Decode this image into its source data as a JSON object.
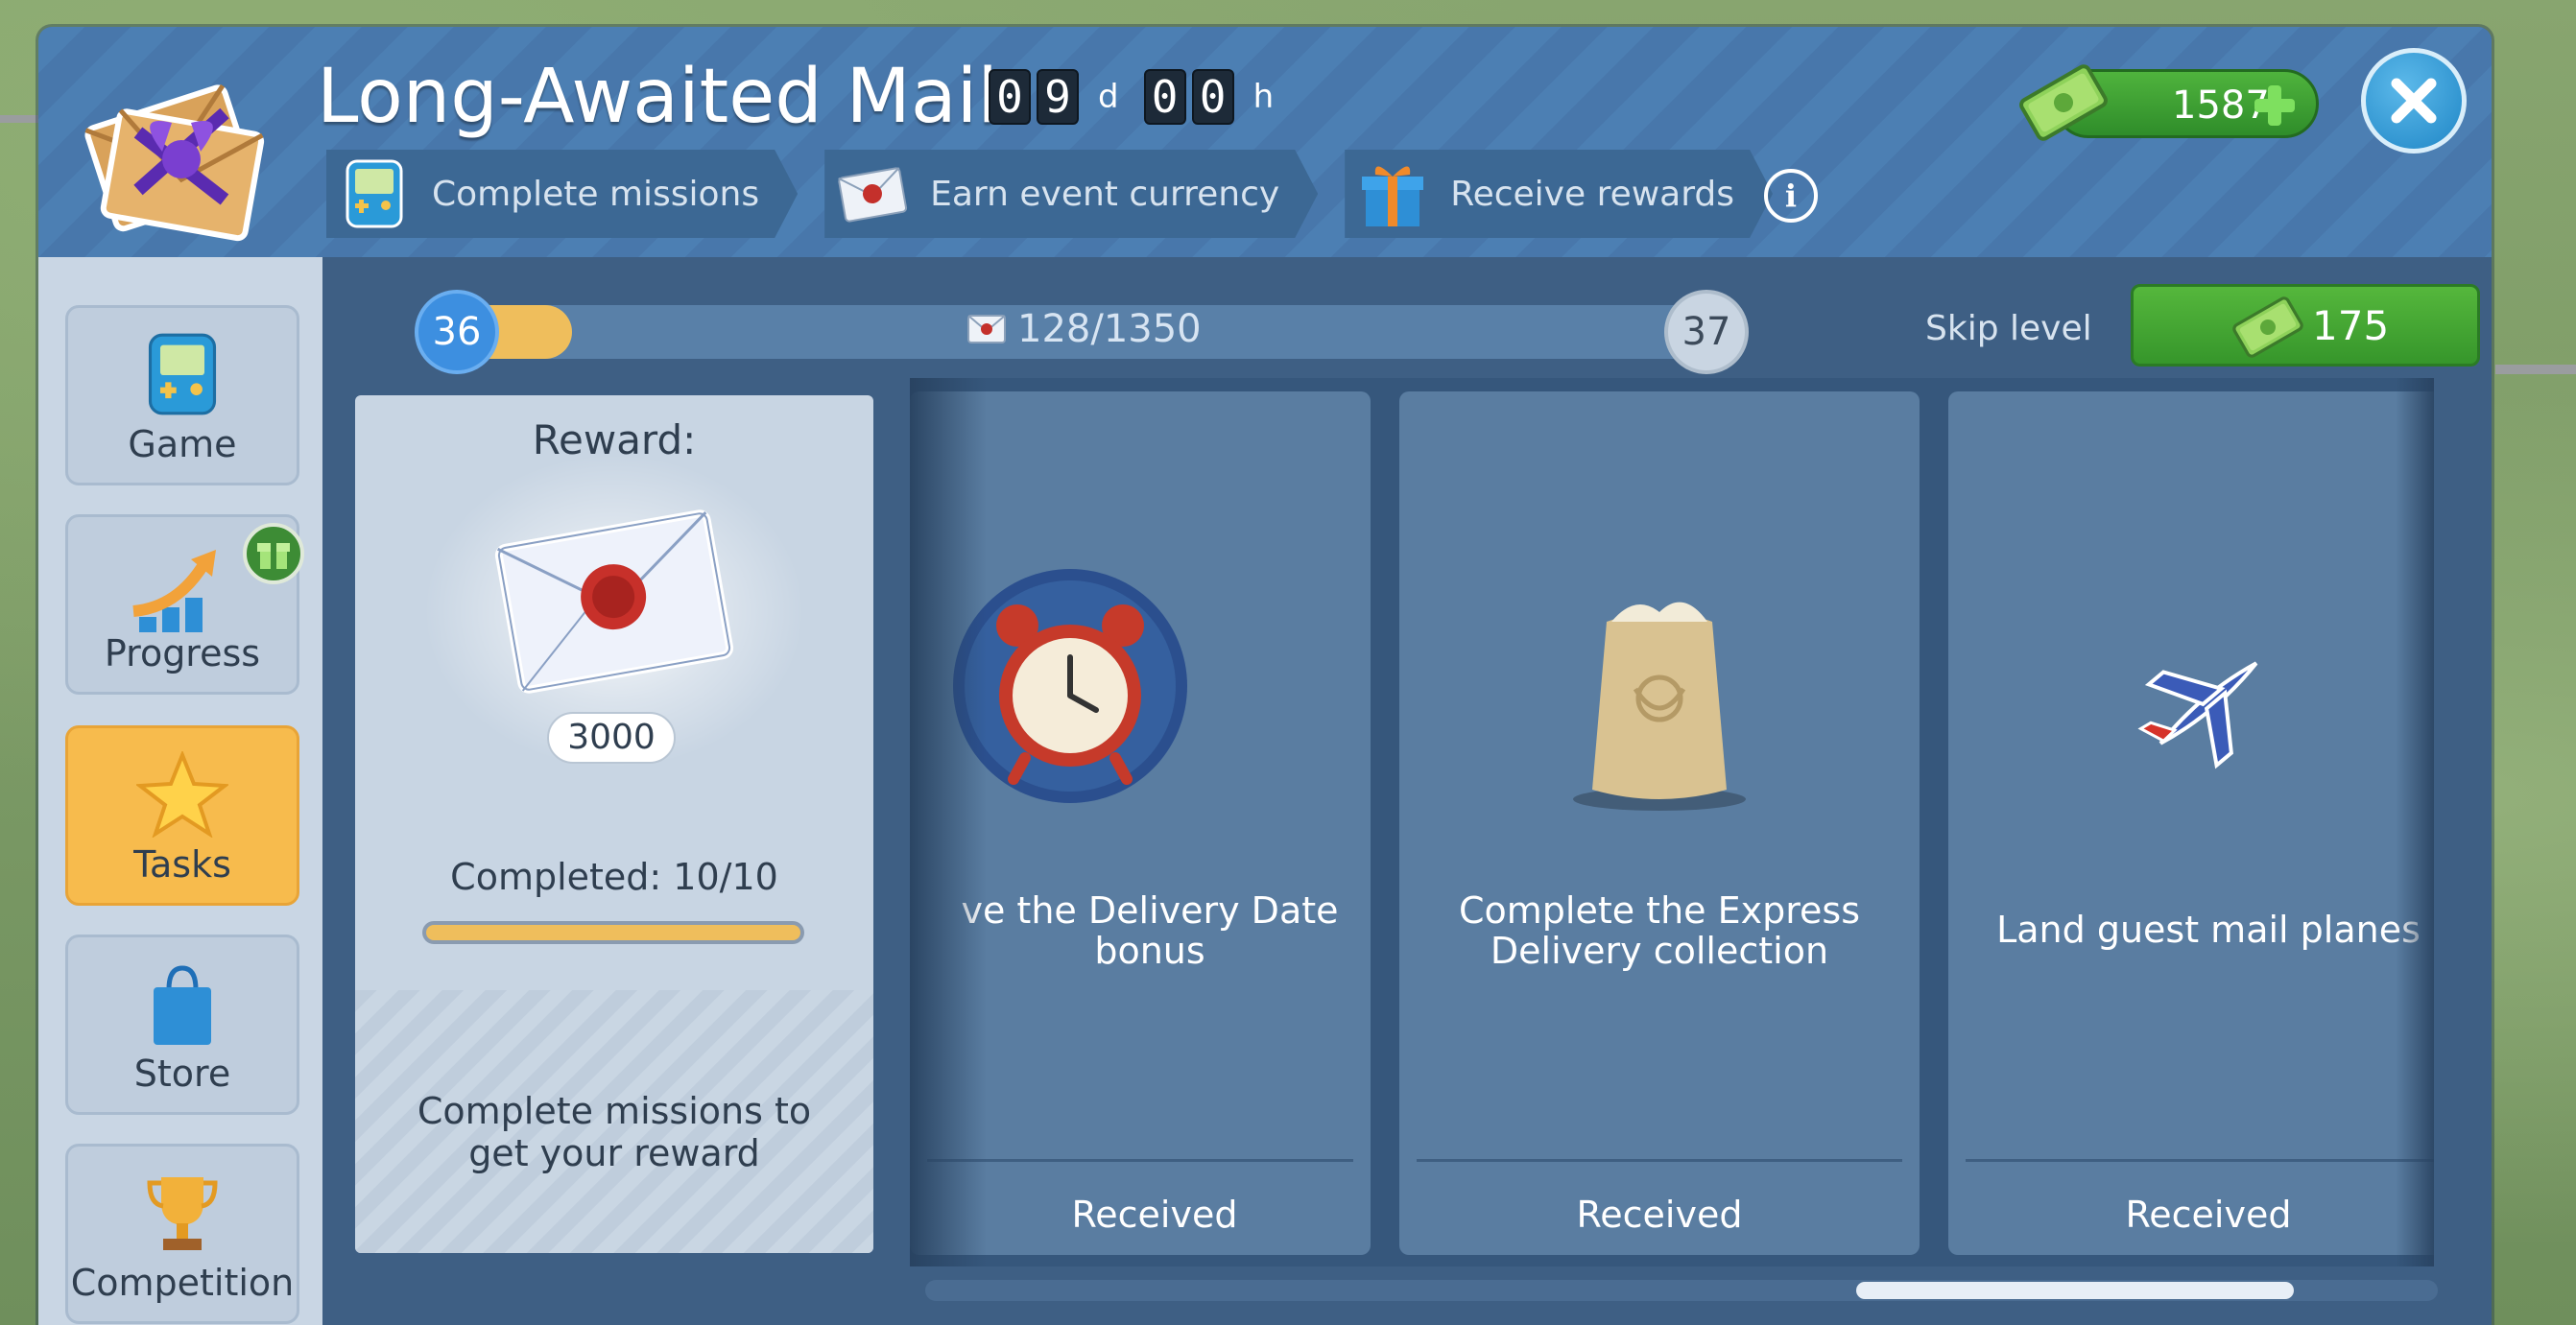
{
  "event": {
    "title": "Long-Awaited Mail",
    "timer": {
      "days_digits": [
        "0",
        "9"
      ],
      "days_unit": "d",
      "hours_digits": [
        "0",
        "0"
      ],
      "hours_unit": "h"
    }
  },
  "steps": [
    {
      "label": "Complete missions",
      "icon": "game-console-icon"
    },
    {
      "label": "Earn event currency",
      "icon": "envelope-icon"
    },
    {
      "label": "Receive rewards",
      "icon": "gift-icon"
    }
  ],
  "currency": {
    "value": "1587",
    "icon": "cash-icon"
  },
  "sidebar": {
    "items": [
      {
        "label": "Game",
        "icon": "game-console-icon",
        "active": false
      },
      {
        "label": "Progress",
        "icon": "progress-chart-icon",
        "active": false
      },
      {
        "label": "Tasks",
        "icon": "star-icon",
        "active": true
      },
      {
        "label": "Store",
        "icon": "shopping-bag-icon",
        "active": false
      },
      {
        "label": "Competition",
        "icon": "trophy-icon",
        "active": false
      }
    ]
  },
  "level": {
    "current": "36",
    "next": "37",
    "progress_text": "128/1350",
    "progress_fraction": 0.095,
    "skip_label": "Skip level",
    "skip_cost": "175"
  },
  "reward": {
    "title": "Reward:",
    "count": "3000",
    "completed": "Completed: 10/10",
    "completed_fraction": 1.0,
    "hint": "Complete missions to get your reward"
  },
  "tasks": [
    {
      "title": "ve the Delivery Date bonus",
      "status": "Received",
      "icon": "alarm-clock-icon"
    },
    {
      "title": "Complete the Express Delivery collection",
      "status": "Received",
      "icon": "mail-bag-icon"
    },
    {
      "title": "Land guest mail planes",
      "status": "Received",
      "icon": "airplane-icon"
    }
  ],
  "colors": {
    "header": "#4c7fb3",
    "panel": "#3e5f84",
    "accent_green": "#4fb33d",
    "active_tab": "#f7bb4d",
    "progress_fill": "#efbe5c"
  }
}
